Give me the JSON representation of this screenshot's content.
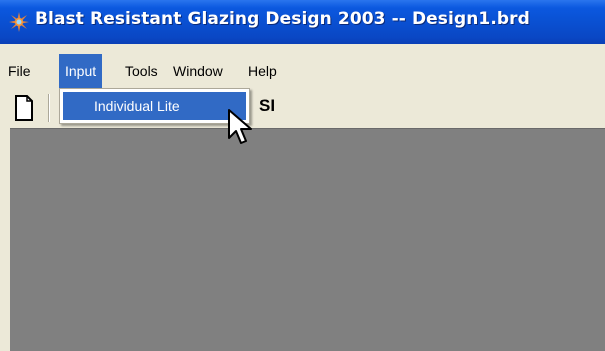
{
  "window": {
    "title": "Blast Resistant Glazing Design 2003 -- Design1.brd"
  },
  "menubar": {
    "items": [
      "File",
      "Input",
      "Tools",
      "Window",
      "Help"
    ],
    "active": "Input"
  },
  "input_menu": {
    "items": [
      "Individual Lite"
    ]
  },
  "toolbar": {
    "units": "SI",
    "icons": [
      "new-document-icon"
    ]
  },
  "colors": {
    "title_bar": "#0a4fd0",
    "menu_highlight": "#316ac5",
    "client_area": "#808080",
    "chrome": "#ece9d8"
  }
}
